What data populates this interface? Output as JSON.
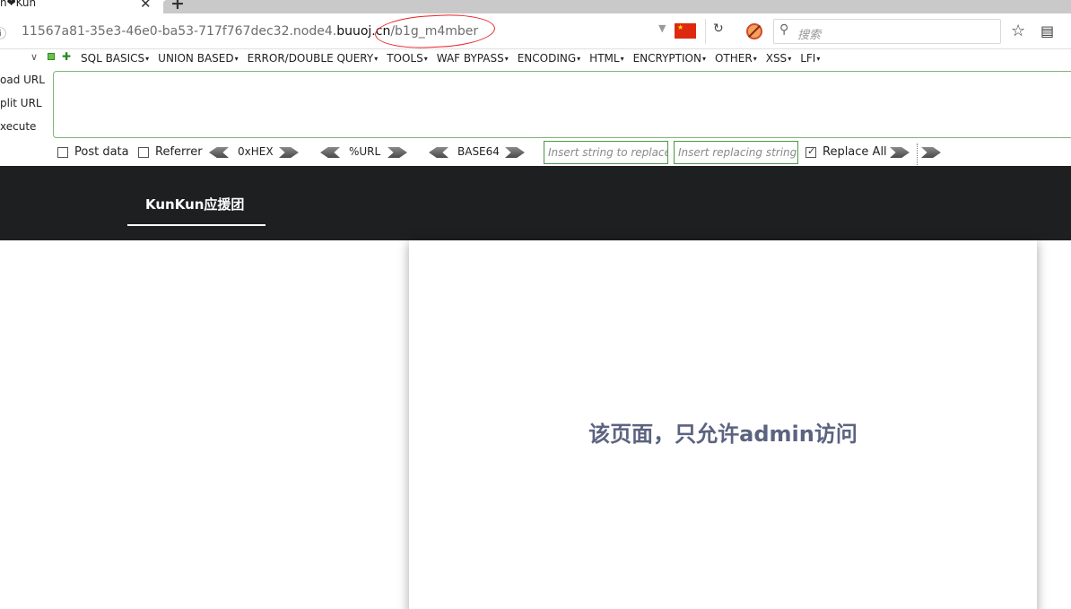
{
  "browser": {
    "tab": {
      "title": "n❤Kun",
      "close_glyph": "✕",
      "new_tab_glyph": "+"
    },
    "url": {
      "prefix": "11567a81-35e3-46e0-ba53-717f767dec32.node4.",
      "host": "buuoj.cn",
      "path": "/b1g_m4mber"
    },
    "search_placeholder": "搜索"
  },
  "hackbar": {
    "menus": [
      "SQL BASICS",
      "UNION BASED",
      "ERROR/DOUBLE QUERY",
      "TOOLS",
      "WAF BYPASS",
      "ENCODING",
      "HTML",
      "ENCRYPTION",
      "OTHER",
      "XSS",
      "LFI"
    ],
    "side_actions": [
      "oad URL",
      "plit URL",
      "xecute"
    ],
    "post_data_label": "Post data",
    "referrer_label": "Referrer",
    "hex_label": "0xHEX",
    "url_label": "%URL",
    "base64_label": "BASE64",
    "replace_find_placeholder": "Insert string to replace",
    "replace_with_placeholder": "Insert replacing string",
    "replace_all_label": "Replace All",
    "post_data_checked": false,
    "referrer_checked": false,
    "replace_all_checked": true
  },
  "site": {
    "brand": "KunKun应援团",
    "message": "该页面，只允许admin访问"
  },
  "colors": {
    "nav_bg": "#1e1f21",
    "message_color": "#5c6380",
    "annotation_red": "#e8252a"
  }
}
